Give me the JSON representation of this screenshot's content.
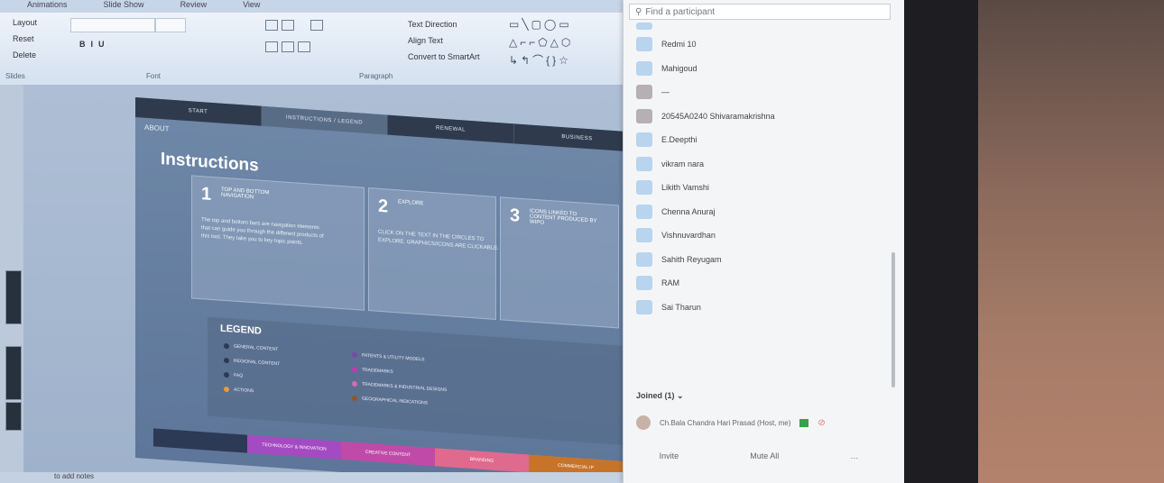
{
  "menubar": {
    "items": [
      "Animations",
      "Slide Show",
      "Review",
      "View"
    ]
  },
  "ribbon": {
    "slides_group": {
      "layout": "Layout",
      "reset": "Reset",
      "delete": "Delete",
      "label": "Slides"
    },
    "font_label": "Font",
    "paragraph_label": "Paragraph",
    "text_direction": "Text Direction",
    "align_text": "Align Text",
    "convert_smartart": "Convert to SmartArt"
  },
  "slide": {
    "nav_top": [
      "START",
      "INSTRUCTIONS / LEGEND",
      "RENEWAL",
      "BUSINESS"
    ],
    "about": "ABOUT",
    "title": "Instructions",
    "cards": [
      {
        "num": "1",
        "title": "TOP AND BOTTOM NAVIGATION",
        "body": "The top and bottom bars are navigation elements that can guide you through the different products of this tool. They take you to key topic points."
      },
      {
        "num": "2",
        "title": "EXPLORE",
        "body": "CLICK ON THE TEXT IN THE CIRCLES TO EXPLORE. GRAPHICS/ICONS ARE CLICKABLE."
      },
      {
        "num": "3",
        "title": "ICONS LINKED TO CONTENT PRODUCED BY WIPO",
        "body": ""
      }
    ],
    "legend_title": "LEGEND",
    "legend_items": [
      "GENERAL CONTENT",
      "REGIONAL CONTENT",
      "FAQ",
      "ACTIONS",
      "PATENTS & UTILITY MODELS",
      "TRADEMARKS",
      "TRADEMARKS & INDUSTRIAL DESIGNS",
      "GEOGRAPHICAL INDICATIONS"
    ],
    "nav_bottom": [
      "",
      "TECHNOLOGY & INNOVATION",
      "CREATIVE CONTENT",
      "BRANDING",
      "COMMERCIAL IP"
    ]
  },
  "status": {
    "notes": "to add notes"
  },
  "participants": {
    "search_placeholder": "Find a participant",
    "list": [
      "Redmi 10",
      "Mahigoud",
      "—",
      "20545A0240 Shivaramakrishna",
      "E.Deepthi",
      "vikram nara",
      "Likith Vamshi",
      "Chenna Anuraj",
      "Vishnuvardhan",
      "Sahith Reyugam",
      "RAM",
      "Sai Tharun"
    ],
    "joined_header": "Joined (1)",
    "joined_member": "Ch.Bala Chandra Hari Prasad (Host, me)",
    "buttons": {
      "invite": "Invite",
      "mute_all": "Mute All"
    }
  },
  "colors": {
    "slide_nav_dark": "#2f3b4d",
    "legend_colors": [
      "#2b3a55",
      "#2b3a55",
      "#2b3a55",
      "#e89a3c",
      "#7a4aa8",
      "#c03ab0",
      "#d36ab8",
      "#8a5a2a"
    ],
    "nav_bottom_colors": [
      "#2d3a55",
      "#a44bc2",
      "#c04aa8",
      "#e06a8e",
      "#c7742a"
    ]
  }
}
